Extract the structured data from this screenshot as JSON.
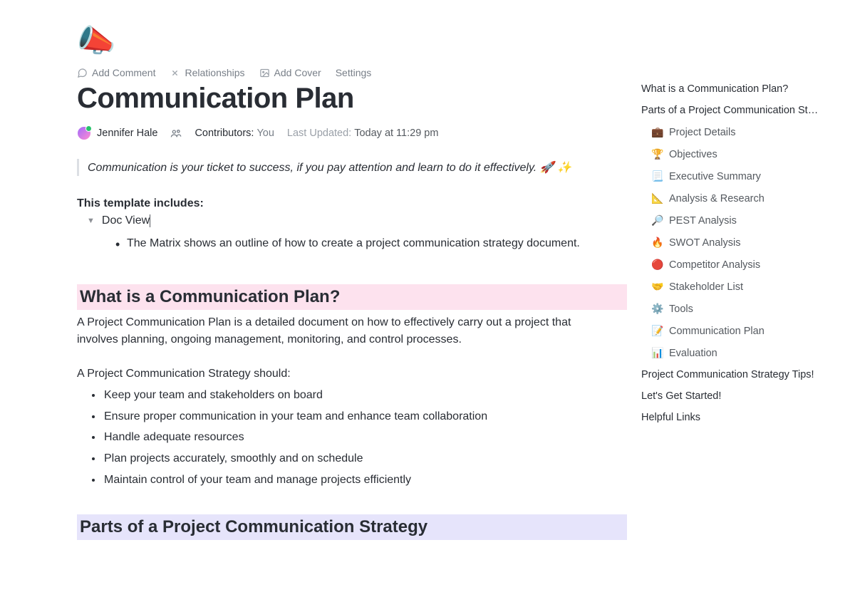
{
  "header": {
    "icon": "📣",
    "toolbar": {
      "add_comment": "Add Comment",
      "relationships": "Relationships",
      "add_cover": "Add Cover",
      "settings": "Settings"
    },
    "title": "Communication Plan",
    "author": "Jennifer Hale",
    "contributors_label": "Contributors:",
    "contributors_value": "You",
    "updated_label": "Last Updated:",
    "updated_value": "Today at 11:29 pm"
  },
  "quote": "Communication is your ticket to success, if you pay attention and learn to do it effectively. 🚀 ✨",
  "template_includes_label": "This template includes:",
  "toggle": {
    "label": "Doc View",
    "bullet": "The Matrix shows an outline of how to create a project communication strategy document."
  },
  "section1": {
    "heading": "What is a Communication Plan?",
    "body": "A Project Communication Plan is a detailed document on how to effectively carry out a project that involves planning, ongoing management, monitoring, and control processes.",
    "subhead": "A Project Communication Strategy should:",
    "bullets": [
      "Keep your team and stakeholders on board",
      "Ensure proper communication in your team and enhance team collaboration",
      "Handle adequate resources",
      "Plan projects accurately, smoothly and on schedule",
      "Maintain control of your team and manage projects efficiently"
    ]
  },
  "section2": {
    "heading": "Parts of a Project Communication Strategy"
  },
  "toc": {
    "top": [
      "What is a Communication Plan?",
      "Parts of a Project Communication St…"
    ],
    "sub": [
      {
        "icon": "💼",
        "label": "Project Details"
      },
      {
        "icon": "🏆",
        "label": "Objectives"
      },
      {
        "icon": "📃",
        "label": "Executive Summary"
      },
      {
        "icon": "📐",
        "label": "Analysis & Research"
      },
      {
        "icon": "🔎",
        "label": "PEST Analysis"
      },
      {
        "icon": "🔥",
        "label": "SWOT Analysis"
      },
      {
        "icon": "🔴",
        "label": "Competitor Analysis"
      },
      {
        "icon": "🤝",
        "label": "Stakeholder List"
      },
      {
        "icon": "⚙️",
        "label": "Tools"
      },
      {
        "icon": "📝",
        "label": "Communication Plan"
      },
      {
        "icon": "📊",
        "label": "Evaluation"
      }
    ],
    "bottom": [
      "Project Communication Strategy Tips!",
      "Let's Get Started!",
      "Helpful Links"
    ]
  }
}
